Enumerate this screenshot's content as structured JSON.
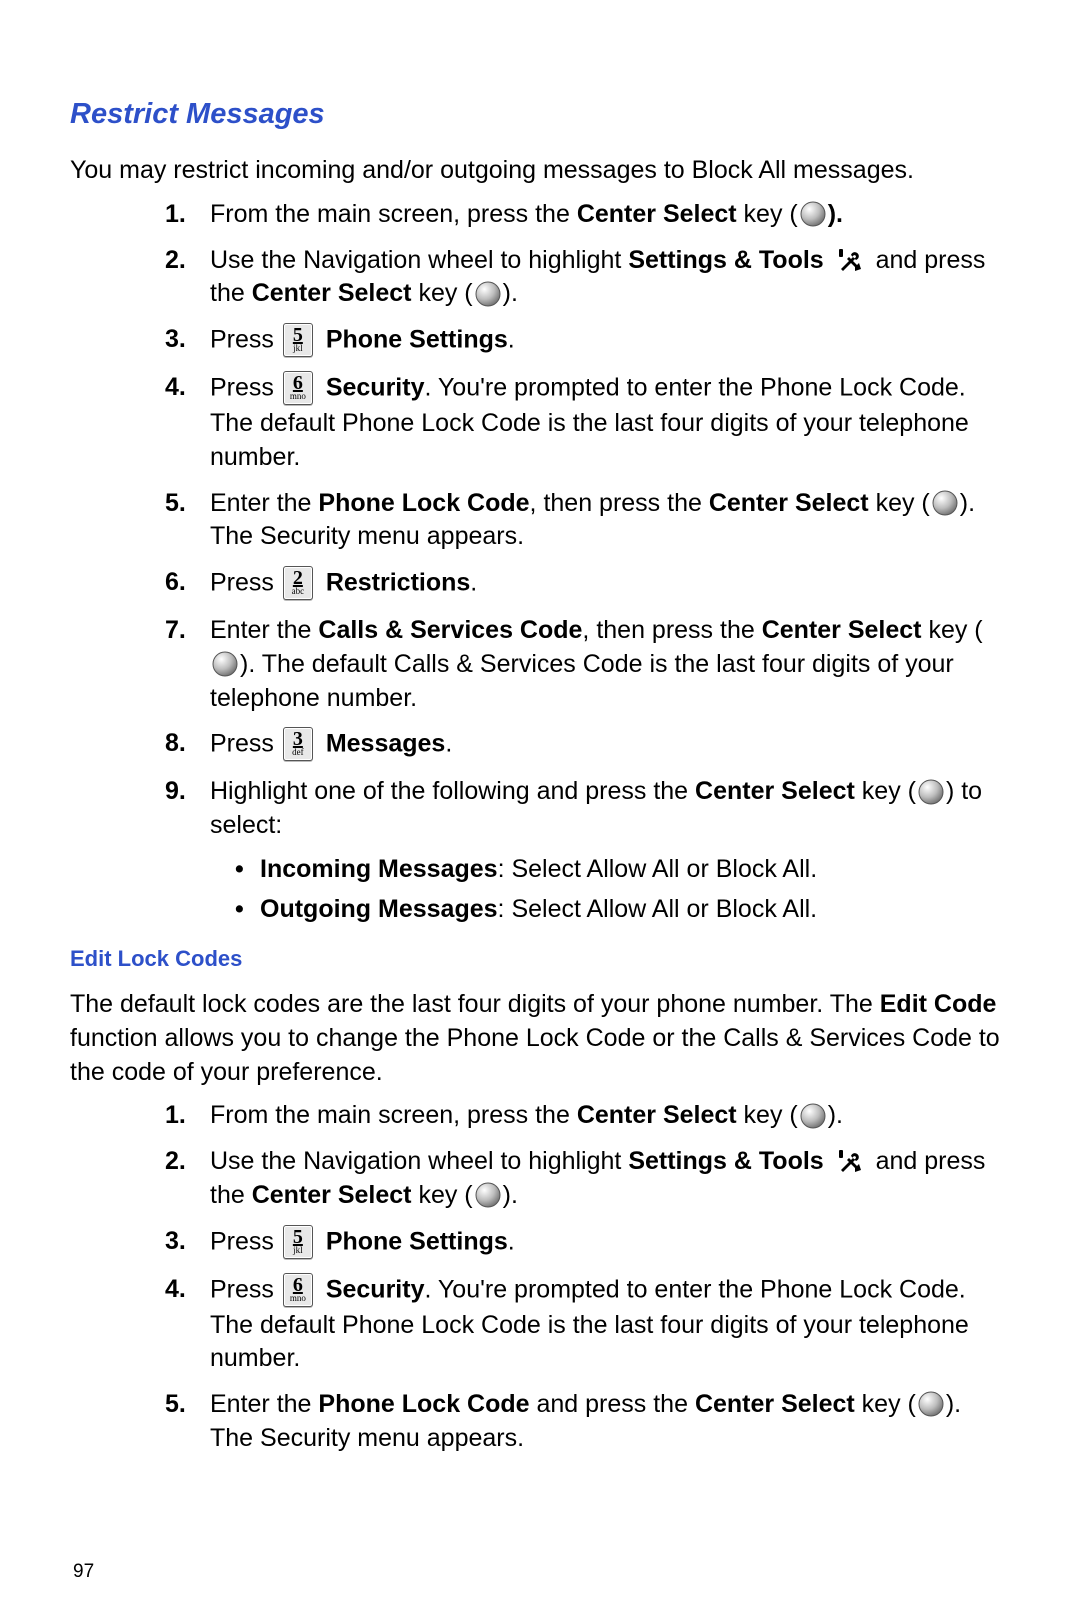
{
  "page_number": "97",
  "section1": {
    "title": "Restrict Messages",
    "intro": "You may restrict incoming and/or outgoing messages to Block All messages.",
    "steps": {
      "s1_a": "From the main screen, press the ",
      "s1_b": "Center Select",
      "s1_c": " key (",
      "s1_d": ").",
      "s2_a": "Use the Navigation wheel to highlight ",
      "s2_b": "Settings & Tools",
      "s2_c": " and press the ",
      "s2_d": "Center Select",
      "s2_e": " key (",
      "s2_f": ").",
      "s3_a": "Press ",
      "s3_b": "Phone Settings",
      "s3_c": ".",
      "s4_a": "Press ",
      "s4_b": "Security",
      "s4_c": ". You're prompted to enter the Phone Lock Code. The default Phone Lock Code is the last four digits of your telephone number.",
      "s5_a": "Enter the ",
      "s5_b": "Phone Lock Code",
      "s5_c": ", then press the ",
      "s5_d": "Center Select",
      "s5_e": " key (",
      "s5_f": "). The Security menu appears.",
      "s6_a": "Press ",
      "s6_b": "Restrictions",
      "s6_c": ".",
      "s7_a": "Enter the ",
      "s7_b": "Calls & Services Code",
      "s7_c": ", then press the ",
      "s7_d": "Center Select",
      "s7_e": " key (",
      "s7_f": "). The default Calls & Services Code is the last four digits of your telephone number.",
      "s8_a": "Press ",
      "s8_b": "Messages",
      "s8_c": ".",
      "s9_a": "Highlight one of the following and press the ",
      "s9_b": "Center Select",
      "s9_c": " key (",
      "s9_d": ") to select:",
      "b1_a": "Incoming Messages",
      "b1_b": ": Select Allow All or Block All.",
      "b2_a": "Outgoing Messages",
      "b2_b": ": Select Allow All or Block All."
    },
    "keys": {
      "k5_n": "5",
      "k5_s": "jkl",
      "k6_n": "6",
      "k6_s": "mno",
      "k2_n": "2",
      "k2_s": "abc",
      "k3_n": "3",
      "k3_s": "def"
    }
  },
  "section2": {
    "title": "Edit Lock Codes",
    "intro_a": "The default lock codes are the last four digits of your phone number. The ",
    "intro_b": "Edit Code",
    "intro_c": " function allows you to change the Phone Lock Code or the Calls & Services Code to the code of your preference.",
    "steps": {
      "s1_a": "From the main screen, press the ",
      "s1_b": "Center Select",
      "s1_c": " key (",
      "s1_d": ").",
      "s2_a": "Use the Navigation wheel to highlight ",
      "s2_b": "Settings & Tools",
      "s2_c": " and press the ",
      "s2_d": "Center Select",
      "s2_e": " key (",
      "s2_f": ").",
      "s3_a": "Press ",
      "s3_b": "Phone Settings",
      "s3_c": ".",
      "s4_a": "Press ",
      "s4_b": "Security",
      "s4_c": ". You're prompted to enter the Phone Lock Code. The default Phone Lock Code is the last four digits of your telephone number.",
      "s5_a": "Enter the ",
      "s5_b": "Phone Lock Code",
      "s5_c": " and press the ",
      "s5_d": "Center Select",
      "s5_e": " key (",
      "s5_f": "). The Security menu appears."
    },
    "keys": {
      "k5_n": "5",
      "k5_s": "jkl",
      "k6_n": "6",
      "k6_s": "mno"
    }
  }
}
